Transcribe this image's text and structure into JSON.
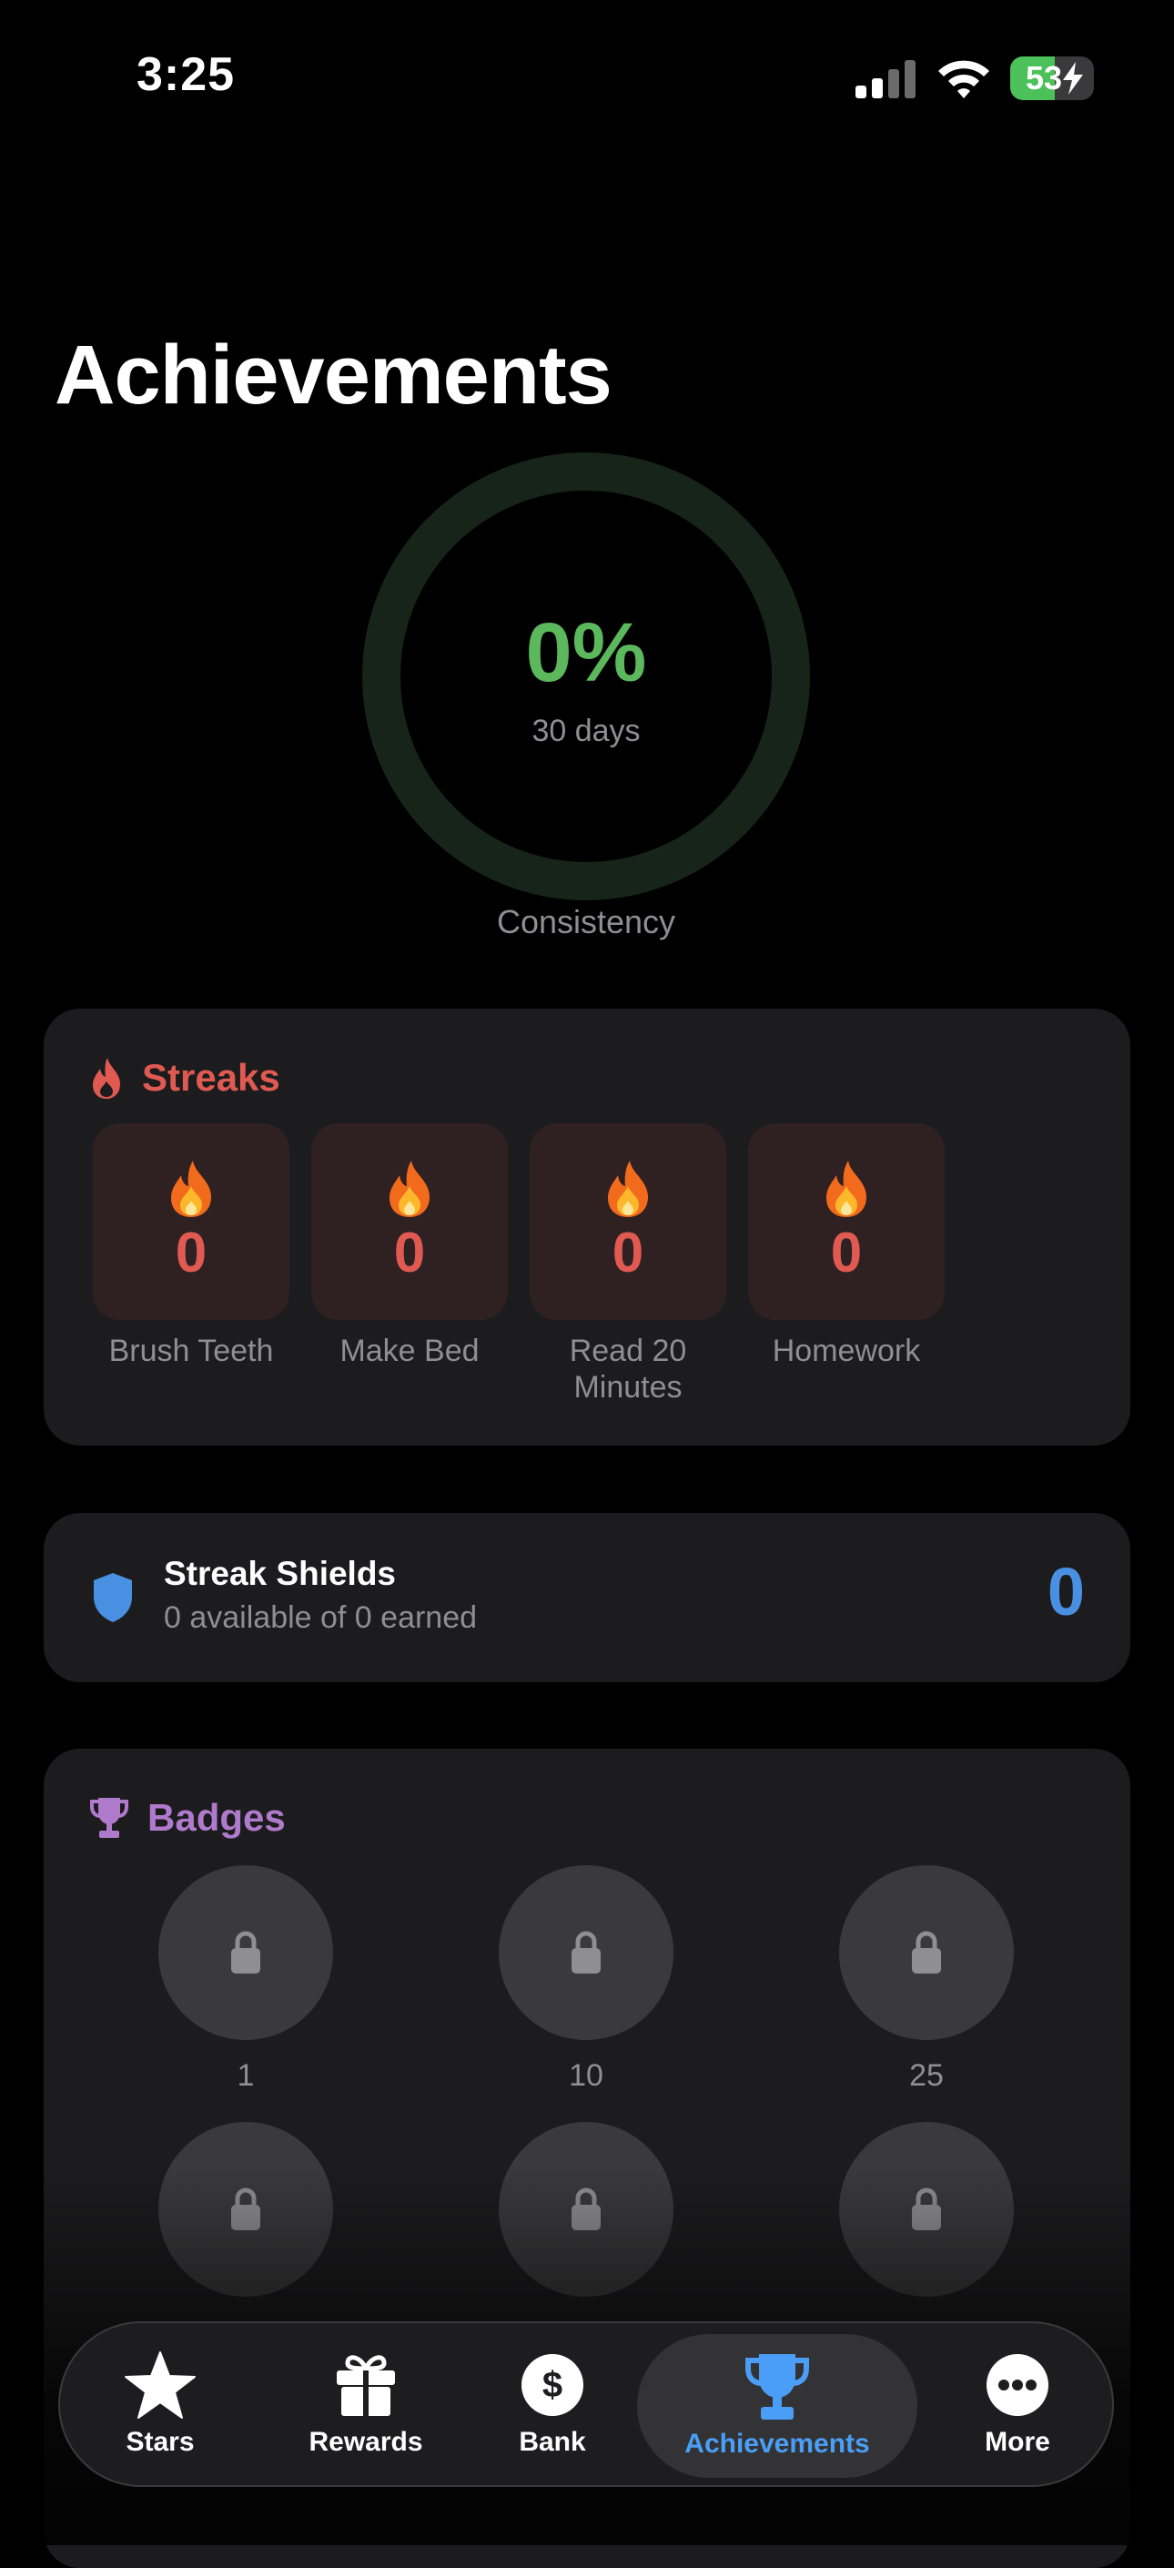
{
  "status_bar": {
    "time": "3:25",
    "battery": "53",
    "battery_level": 0.53
  },
  "page": {
    "title": "Achievements"
  },
  "consistency": {
    "value": "0%",
    "period": "30 days",
    "caption": "Consistency",
    "progress": 0
  },
  "streaks": {
    "title": "Streaks",
    "items": [
      {
        "count": "0",
        "label": "Brush Teeth"
      },
      {
        "count": "0",
        "label": "Make Bed"
      },
      {
        "count": "0",
        "label": "Read 20 Minutes"
      },
      {
        "count": "0",
        "label": "Homework"
      }
    ]
  },
  "shields": {
    "title": "Streak Shields",
    "subtitle": "0 available of 0 earned",
    "count": "0"
  },
  "badges": {
    "title": "Badges",
    "items": [
      {
        "label": "1"
      },
      {
        "label": "10"
      },
      {
        "label": "25"
      },
      {
        "label": ""
      },
      {
        "label": ""
      },
      {
        "label": ""
      }
    ]
  },
  "tabbar": {
    "tabs": [
      {
        "label": "Stars",
        "icon": "star-icon"
      },
      {
        "label": "Rewards",
        "icon": "gift-icon"
      },
      {
        "label": "Bank",
        "icon": "dollar-icon"
      },
      {
        "label": "Achievements",
        "icon": "trophy-icon",
        "active": true
      },
      {
        "label": "More",
        "icon": "ellipsis-icon"
      }
    ]
  },
  "colors": {
    "streak_accent": "#e05a52",
    "badge_accent": "#b07acc",
    "shield_accent": "#4a90e2",
    "ring_accent": "#5cb85c",
    "active_tab": "#4a9ef5"
  }
}
